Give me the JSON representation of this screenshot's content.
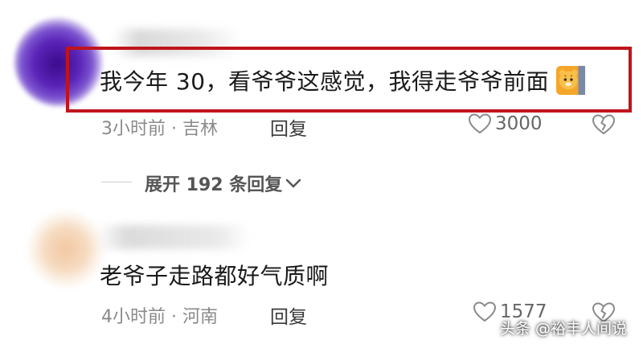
{
  "comments": [
    {
      "text": "我今年 30，看爷爷这感觉，我得走爷爷前面",
      "emoji": "tiger-emoji",
      "time_location": "3小时前 · 吉林",
      "reply_label": "回复",
      "likes": "3000"
    },
    {
      "text": "老爷子走路都好气质啊",
      "time_location": "4小时前 · 河南",
      "reply_label": "回复",
      "likes": "1577"
    }
  ],
  "expand_replies": "展开 192 条回复",
  "watermark": "头条 @裕丰人间说",
  "colors": {
    "highlight": "#c0141b",
    "meta": "#8a8a8a"
  }
}
